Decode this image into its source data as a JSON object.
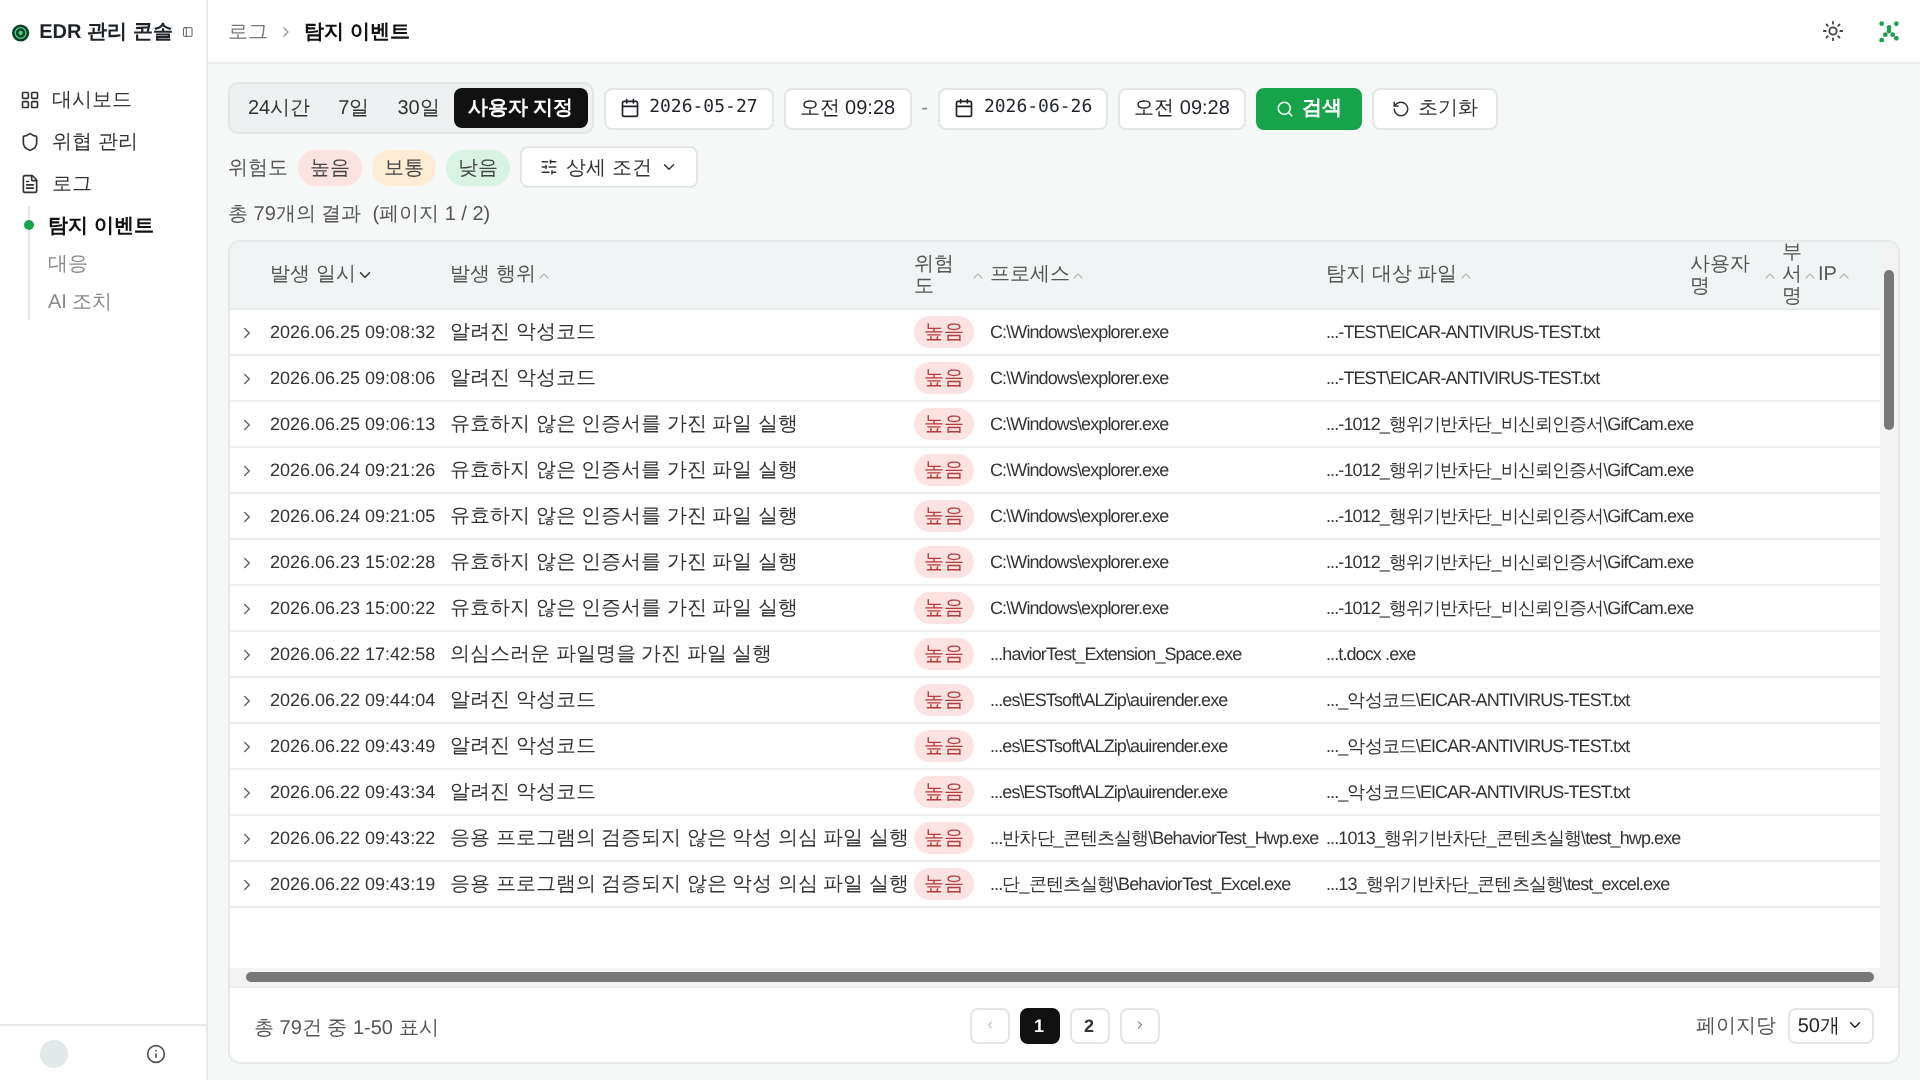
{
  "app": {
    "title": "EDR 관리 콘솔"
  },
  "sidebar": {
    "items": [
      {
        "label": "대시보드"
      },
      {
        "label": "위협 관리"
      },
      {
        "label": "로그",
        "children": [
          {
            "label": "탐지 이벤트",
            "selected": true
          },
          {
            "label": "대응",
            "selected": false
          },
          {
            "label": "AI 조치",
            "selected": false
          }
        ]
      }
    ]
  },
  "breadcrumb": [
    "로그",
    "탐지 이벤트"
  ],
  "range_tabs": [
    {
      "label": "24시간",
      "selected": false
    },
    {
      "label": "7일",
      "selected": false
    },
    {
      "label": "30일",
      "selected": false
    },
    {
      "label": "사용자 지정",
      "selected": true
    }
  ],
  "date_from": {
    "date": "2026-05-27",
    "time": "오전 09:28"
  },
  "range_separator": "-",
  "date_to": {
    "date": "2026-06-26",
    "time": "오전 09:28"
  },
  "search_button": "검색",
  "reset_button": "초기화",
  "risk_filter": {
    "label": "위험도",
    "chips": [
      {
        "label": "높음",
        "color": "#fde2e2"
      },
      {
        "label": "보통",
        "color": "#fdebd3"
      },
      {
        "label": "낮음",
        "color": "#d8f2e3"
      }
    ]
  },
  "detail_button": "상세 조건",
  "result_summary": "총 79개의 결과  (페이지 1 / 2)",
  "table": {
    "columns": [
      {
        "label": "발생 일시",
        "sorted": true
      },
      {
        "label": "발생 행위",
        "sorted": false
      },
      {
        "label": "위험도",
        "sorted": false
      },
      {
        "label": "프로세스",
        "sorted": false
      },
      {
        "label": "탐지 대상 파일",
        "sorted": false
      },
      {
        "label": "사용자명",
        "sorted": false
      },
      {
        "label": "부서명",
        "sorted": false
      },
      {
        "label": "IP",
        "sorted": false
      }
    ],
    "rows": [
      {
        "time": "2026.06.25 09:08:32",
        "action": "알려진 악성코드",
        "risk": "높음",
        "process": "C:\\Windows\\explorer.exe",
        "target": "...-TEST\\EICAR-ANTIVIRUS-TEST.txt"
      },
      {
        "time": "2026.06.25 09:08:06",
        "action": "알려진 악성코드",
        "risk": "높음",
        "process": "C:\\Windows\\explorer.exe",
        "target": "...-TEST\\EICAR-ANTIVIRUS-TEST.txt"
      },
      {
        "time": "2026.06.25 09:06:13",
        "action": "유효하지 않은 인증서를 가진 파일 실행",
        "risk": "높음",
        "process": "C:\\Windows\\explorer.exe",
        "target": "...-1012_행위기반차단_비신뢰인증서\\GifCam.exe"
      },
      {
        "time": "2026.06.24 09:21:26",
        "action": "유효하지 않은 인증서를 가진 파일 실행",
        "risk": "높음",
        "process": "C:\\Windows\\explorer.exe",
        "target": "...-1012_행위기반차단_비신뢰인증서\\GifCam.exe"
      },
      {
        "time": "2026.06.24 09:21:05",
        "action": "유효하지 않은 인증서를 가진 파일 실행",
        "risk": "높음",
        "process": "C:\\Windows\\explorer.exe",
        "target": "...-1012_행위기반차단_비신뢰인증서\\GifCam.exe"
      },
      {
        "time": "2026.06.23 15:02:28",
        "action": "유효하지 않은 인증서를 가진 파일 실행",
        "risk": "높음",
        "process": "C:\\Windows\\explorer.exe",
        "target": "...-1012_행위기반차단_비신뢰인증서\\GifCam.exe"
      },
      {
        "time": "2026.06.23 15:00:22",
        "action": "유효하지 않은 인증서를 가진 파일 실행",
        "risk": "높음",
        "process": "C:\\Windows\\explorer.exe",
        "target": "...-1012_행위기반차단_비신뢰인증서\\GifCam.exe"
      },
      {
        "time": "2026.06.22 17:42:58",
        "action": "의심스러운 파일명을 가진 파일 실행",
        "risk": "높음",
        "process": "...haviorTest_Extension_Space.exe",
        "target": "...t.docx .exe"
      },
      {
        "time": "2026.06.22 09:44:04",
        "action": "알려진 악성코드",
        "risk": "높음",
        "process": "...es\\ESTsoft\\ALZip\\auirender.exe",
        "target": "..._악성코드\\EICAR-ANTIVIRUS-TEST.txt"
      },
      {
        "time": "2026.06.22 09:43:49",
        "action": "알려진 악성코드",
        "risk": "높음",
        "process": "...es\\ESTsoft\\ALZip\\auirender.exe",
        "target": "..._악성코드\\EICAR-ANTIVIRUS-TEST.txt"
      },
      {
        "time": "2026.06.22 09:43:34",
        "action": "알려진 악성코드",
        "risk": "높음",
        "process": "...es\\ESTsoft\\ALZip\\auirender.exe",
        "target": "..._악성코드\\EICAR-ANTIVIRUS-TEST.txt"
      },
      {
        "time": "2026.06.22 09:43:22",
        "action": "응용 프로그램의 검증되지 않은 악성 의심 파일 실행",
        "risk": "높음",
        "process": "...반차단_콘텐츠실행\\BehaviorTest_Hwp.exe",
        "target": "...1013_행위기반차단_콘텐츠실행\\test_hwp.exe"
      },
      {
        "time": "2026.06.22 09:43:19",
        "action": "응용 프로그램의 검증되지 않은 악성 의심 파일 실행",
        "risk": "높음",
        "process": "...단_콘텐츠실행\\BehaviorTest_Excel.exe",
        "target": "...13_행위기반차단_콘텐츠실행\\test_excel.exe"
      }
    ]
  },
  "footer": {
    "summary": "총 79건 중 1-50 표시",
    "pages": [
      {
        "label": "1",
        "selected": true
      },
      {
        "label": "2",
        "selected": false
      }
    ],
    "per_page_label": "페이지당",
    "per_page": "50개"
  }
}
